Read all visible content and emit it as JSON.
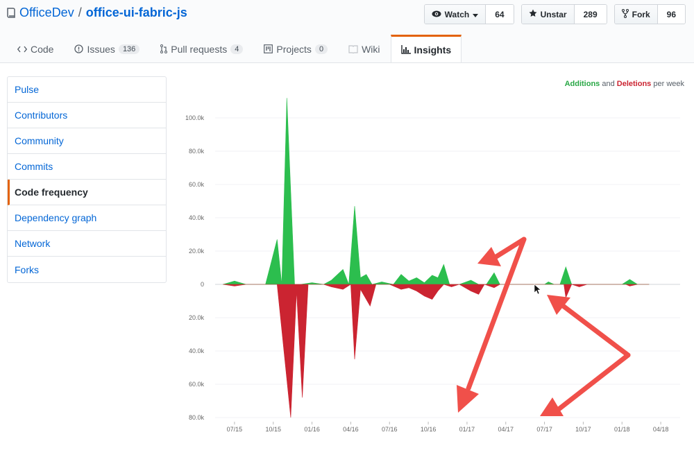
{
  "repo": {
    "owner": "OfficeDev",
    "separator": "/",
    "name": "office-ui-fabric-js"
  },
  "actions": {
    "watch": {
      "label": "Watch",
      "count": "64"
    },
    "star": {
      "label": "Unstar",
      "count": "289"
    },
    "fork": {
      "label": "Fork",
      "count": "96"
    }
  },
  "tabs": [
    {
      "label": "Code",
      "count": ""
    },
    {
      "label": "Issues",
      "count": "136"
    },
    {
      "label": "Pull requests",
      "count": "4"
    },
    {
      "label": "Projects",
      "count": "0"
    },
    {
      "label": "Wiki",
      "count": ""
    },
    {
      "label": "Insights",
      "count": ""
    }
  ],
  "sidebar": {
    "items": [
      {
        "label": "Pulse"
      },
      {
        "label": "Contributors"
      },
      {
        "label": "Community"
      },
      {
        "label": "Commits"
      },
      {
        "label": "Code frequency"
      },
      {
        "label": "Dependency graph"
      },
      {
        "label": "Network"
      },
      {
        "label": "Forks"
      }
    ]
  },
  "legend": {
    "additions": "Additions",
    "and": "and",
    "deletions": "Deletions",
    "suffix": "per week"
  },
  "colors": {
    "additions": "#2cbe4e",
    "deletions": "#cb2431",
    "accent": "#e36209",
    "annotation": "#f0504a"
  },
  "chart_data": {
    "type": "area",
    "y_tick_labels": [
      "100.0k",
      "80.0k",
      "60.0k",
      "40.0k",
      "20.0k",
      "0",
      "20.0k",
      "40.0k",
      "60.0k",
      "80.0k"
    ],
    "y_tick_values": [
      100000,
      80000,
      60000,
      40000,
      20000,
      0,
      -20000,
      -40000,
      -60000,
      -80000
    ],
    "ylim": [
      -80000,
      110000
    ],
    "x_tick_labels": [
      "07/15",
      "10/15",
      "01/16",
      "04/16",
      "07/16",
      "10/16",
      "01/17",
      "04/17",
      "07/17",
      "10/17",
      "01/18",
      "04/18"
    ],
    "xlim": [
      0,
      12
    ],
    "series": [
      {
        "name": "Additions",
        "points": [
          [
            0.2,
            0
          ],
          [
            0.5,
            2000
          ],
          [
            0.8,
            0
          ],
          [
            1.3,
            0
          ],
          [
            1.6,
            27000
          ],
          [
            1.72,
            0
          ],
          [
            1.85,
            112000
          ],
          [
            2.05,
            0
          ],
          [
            2.2,
            0
          ],
          [
            2.5,
            1000
          ],
          [
            2.8,
            0
          ],
          [
            3.0,
            2500
          ],
          [
            3.3,
            9000
          ],
          [
            3.45,
            0
          ],
          [
            3.6,
            47000
          ],
          [
            3.75,
            4000
          ],
          [
            3.9,
            6000
          ],
          [
            4.05,
            0
          ],
          [
            4.3,
            1500
          ],
          [
            4.6,
            0
          ],
          [
            4.8,
            6000
          ],
          [
            5.0,
            2000
          ],
          [
            5.2,
            4000
          ],
          [
            5.4,
            1000
          ],
          [
            5.6,
            5500
          ],
          [
            5.75,
            4000
          ],
          [
            5.9,
            12000
          ],
          [
            6.05,
            0
          ],
          [
            6.3,
            0
          ],
          [
            6.6,
            2500
          ],
          [
            6.8,
            0
          ],
          [
            7.0,
            0
          ],
          [
            7.2,
            7000
          ],
          [
            7.35,
            0
          ],
          [
            8.5,
            0
          ],
          [
            8.6,
            1500
          ],
          [
            8.75,
            0
          ],
          [
            8.9,
            0
          ],
          [
            9.05,
            10500
          ],
          [
            9.2,
            0
          ],
          [
            10.5,
            0
          ],
          [
            10.7,
            3000
          ],
          [
            10.9,
            0
          ],
          [
            11.2,
            0
          ]
        ]
      },
      {
        "name": "Deletions",
        "points": [
          [
            0.2,
            0
          ],
          [
            0.5,
            -1000
          ],
          [
            0.8,
            0
          ],
          [
            1.6,
            0
          ],
          [
            1.95,
            -80000
          ],
          [
            2.1,
            -4000
          ],
          [
            2.25,
            -68000
          ],
          [
            2.4,
            0
          ],
          [
            2.8,
            0
          ],
          [
            3.0,
            -1500
          ],
          [
            3.3,
            -3000
          ],
          [
            3.5,
            0
          ],
          [
            3.6,
            -45000
          ],
          [
            3.75,
            -3000
          ],
          [
            4.0,
            -13000
          ],
          [
            4.15,
            0
          ],
          [
            4.5,
            0
          ],
          [
            4.8,
            -3000
          ],
          [
            5.0,
            -2000
          ],
          [
            5.2,
            -4000
          ],
          [
            5.4,
            -7000
          ],
          [
            5.6,
            -9000
          ],
          [
            5.75,
            -4000
          ],
          [
            5.9,
            0
          ],
          [
            6.1,
            -1500
          ],
          [
            6.3,
            0
          ],
          [
            6.6,
            -4000
          ],
          [
            6.8,
            -6000
          ],
          [
            6.95,
            0
          ],
          [
            7.2,
            -2000
          ],
          [
            7.35,
            0
          ],
          [
            9.0,
            0
          ],
          [
            9.05,
            -8000
          ],
          [
            9.2,
            0
          ],
          [
            9.4,
            -1500
          ],
          [
            9.6,
            0
          ],
          [
            10.6,
            0
          ],
          [
            10.7,
            -1000
          ],
          [
            10.9,
            0
          ],
          [
            11.2,
            0
          ]
        ]
      }
    ]
  }
}
